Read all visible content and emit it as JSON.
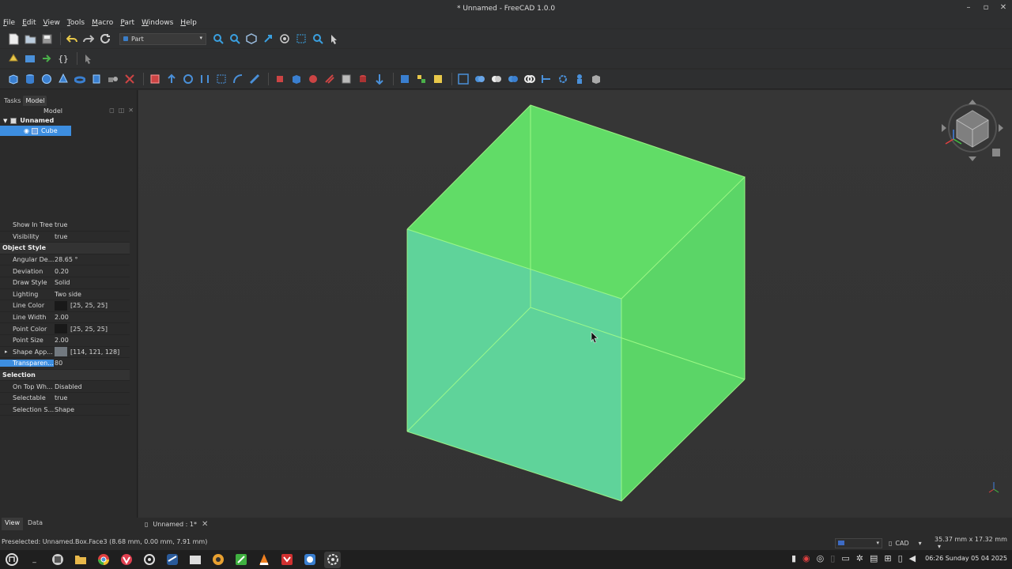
{
  "window": {
    "title": "* Unnamed - FreeCAD 1.0.0",
    "minimize": "–",
    "maximize": "▫",
    "close": "✕"
  },
  "menu": [
    "File",
    "Edit",
    "View",
    "Tools",
    "Macro",
    "Part",
    "Windows",
    "Help"
  ],
  "toolbar": {
    "workbench": "Part"
  },
  "left_panel": {
    "tabs": [
      "Tasks",
      "Model"
    ],
    "tree_header": "Model",
    "document": "Unnamed",
    "object": "Cube",
    "bottom_tabs": [
      "View",
      "Data"
    ]
  },
  "properties": [
    {
      "name": "Show In Tree",
      "value": "true"
    },
    {
      "name": "Visibility",
      "value": "true"
    },
    {
      "group": "Object Style"
    },
    {
      "name": "Angular De...",
      "value": "28.65 °"
    },
    {
      "name": "Deviation",
      "value": "0.20"
    },
    {
      "name": "Draw Style",
      "value": "Solid"
    },
    {
      "name": "Lighting",
      "value": "Two side"
    },
    {
      "name": "Line Color",
      "value": "[25, 25, 25]",
      "swatch": "#191919"
    },
    {
      "name": "Line Width",
      "value": "2.00"
    },
    {
      "name": "Point Color",
      "value": "[25, 25, 25]",
      "swatch": "#191919"
    },
    {
      "name": "Point Size",
      "value": "2.00"
    },
    {
      "name": "Shape App...",
      "value": "[114, 121, 128]",
      "swatch": "#727980",
      "expand": true
    },
    {
      "name": "Transparen...",
      "value": "80",
      "highlight": true
    },
    {
      "group": "Selection"
    },
    {
      "name": "On Top Wh...",
      "value": "Disabled"
    },
    {
      "name": "Selectable",
      "value": "true"
    },
    {
      "name": "Selection S...",
      "value": "Shape"
    }
  ],
  "document_tab": {
    "label": "Unnamed : 1*",
    "close": "✕"
  },
  "status": {
    "preselected": "Preselected: Unnamed.Box.Face3 (8.68 mm, 0.00 mm, 7.91 mm)",
    "nav_style": "CAD",
    "dimensions": "35.37 mm x 17.32 mm"
  },
  "taskbar": {
    "clock": "06:26 Sunday 05 04 2025"
  },
  "colors": {
    "cube_face": "#64e6a0",
    "cube_edge": "#a6ff8a",
    "accent": "#3d8ee0"
  }
}
